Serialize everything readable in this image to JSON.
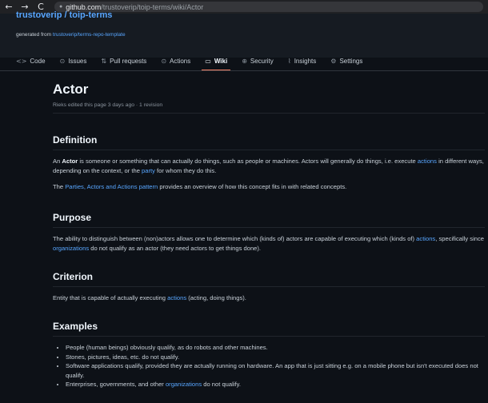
{
  "browser": {
    "back": "←",
    "forward": "→",
    "reload": "C",
    "url_host": "github.com",
    "url_path": "/trustoverip/toip-terms/wiki/Actor"
  },
  "repo": {
    "title": "trustoverip / toip-terms",
    "generated_prefix": "generated from ",
    "generated_link": "trustoverip/terms-repo-template"
  },
  "tabs": [
    {
      "label": "Code",
      "icon": "<>"
    },
    {
      "label": "Issues",
      "icon": "⊙"
    },
    {
      "label": "Pull requests",
      "icon": "⇅"
    },
    {
      "label": "Actions",
      "icon": "⊙"
    },
    {
      "label": "Wiki",
      "icon": "▭"
    },
    {
      "label": "Security",
      "icon": "⊕"
    },
    {
      "label": "Insights",
      "icon": "⌇"
    },
    {
      "label": "Settings",
      "icon": "⚙"
    }
  ],
  "page": {
    "title": "Actor",
    "meta": "Rieks edited this page 3 days ago · 1 revision"
  },
  "definition": {
    "heading": "Definition",
    "p1": {
      "a": "An ",
      "bold": "Actor",
      "b": " is someone or something that can actually do things, such as people or machines. Actors will generally do things, i.e. execute ",
      "link1": "actions",
      "c": " in different ways, depending on the context, or the ",
      "link2": "party",
      "d": " for whom they do this."
    },
    "p2": {
      "a": "The ",
      "link": "Parties, Actors and Actions pattern",
      "b": " provides an overview of how this concept fits in with related concepts."
    }
  },
  "purpose": {
    "heading": "Purpose",
    "p": {
      "a": "The ability to distinguish between (non)actors allows one to determine which (kinds of) actors are capable of executing which (kinds of) ",
      "link1": "actions",
      "b": ", specifically since ",
      "link2": "organizations",
      "c": " do not qualify as an actor (they need actors to get things done)."
    }
  },
  "criterion": {
    "heading": "Criterion",
    "p": {
      "a": "Entity that is capable of actually executing ",
      "link": "actions",
      "b": " (acting, doing things)."
    }
  },
  "examples": {
    "heading": "Examples",
    "items": [
      "People (human beings) obviously qualify, as do robots and other machines.",
      "Stones, pictures, ideas, etc. do not qualify.",
      "Software applications qualify, provided they are actually running on hardware. An app that is just sitting e.g. on a mobile phone but isn't executed does not qualify."
    ],
    "last": {
      "a": "Enterprises, governments, and other ",
      "link": "organizations",
      "b": " do not qualify."
    }
  }
}
